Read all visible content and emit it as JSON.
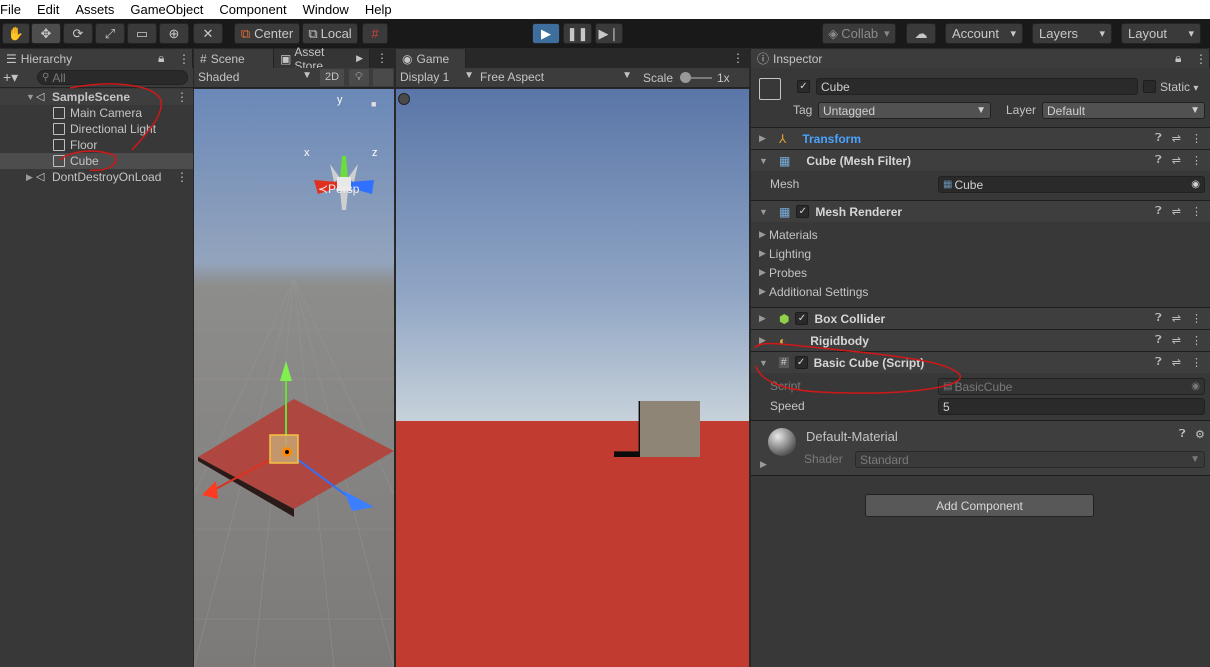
{
  "menu": [
    "File",
    "Edit",
    "Assets",
    "GameObject",
    "Component",
    "Window",
    "Help"
  ],
  "toolbar": {
    "center_label": "Center",
    "local_label": "Local",
    "collab_label": "Collab",
    "account_label": "Account",
    "layers_label": "Layers",
    "layout_label": "Layout"
  },
  "hierarchy": {
    "tab_label": "Hierarchy",
    "search_placeholder": "All",
    "items": [
      {
        "label": "SampleScene"
      },
      {
        "label": "Main Camera"
      },
      {
        "label": "Directional Light"
      },
      {
        "label": "Floor"
      },
      {
        "label": "Cube"
      },
      {
        "label": "DontDestroyOnLoad"
      }
    ]
  },
  "scene": {
    "tab_label": "Scene",
    "asset_store_label": "Asset Store",
    "shading_label": "Shaded",
    "mode_2d_label": "2D",
    "persp_label": "≺Persp",
    "gizmo_y": "y",
    "gizmo_x": "x",
    "gizmo_z": "z"
  },
  "game": {
    "tab_label": "Game",
    "display_label": "Display 1",
    "aspect_label": "Free Aspect",
    "scale_label": "Scale",
    "scale_value": "1x"
  },
  "inspector": {
    "tab_label": "Inspector",
    "object_name": "Cube",
    "static_label": "Static",
    "tag_label": "Tag",
    "tag_value": "Untagged",
    "layer_label": "Layer",
    "layer_value": "Default",
    "components": {
      "transform": "Transform",
      "mesh_filter": "Cube (Mesh Filter)",
      "mesh_label": "Mesh",
      "mesh_value": "Cube",
      "mesh_renderer": "Mesh Renderer",
      "materials": "Materials",
      "lighting": "Lighting",
      "probes": "Probes",
      "additional_settings": "Additional Settings",
      "box_collider": "Box Collider",
      "rigidbody": "Rigidbody",
      "basic_cube": "Basic Cube (Script)",
      "script_label": "Script",
      "script_value": "BasicCube",
      "speed_label": "Speed",
      "speed_value": "5",
      "material_name": "Default-Material",
      "shader_label": "Shader",
      "shader_value": "Standard"
    },
    "add_component_label": "Add Component"
  },
  "colors": {
    "annotation_red": "#d01818",
    "transform_blue": "#4aa3ff",
    "play_blue": "#3d6e9e",
    "floor_red": "#c23b30"
  }
}
